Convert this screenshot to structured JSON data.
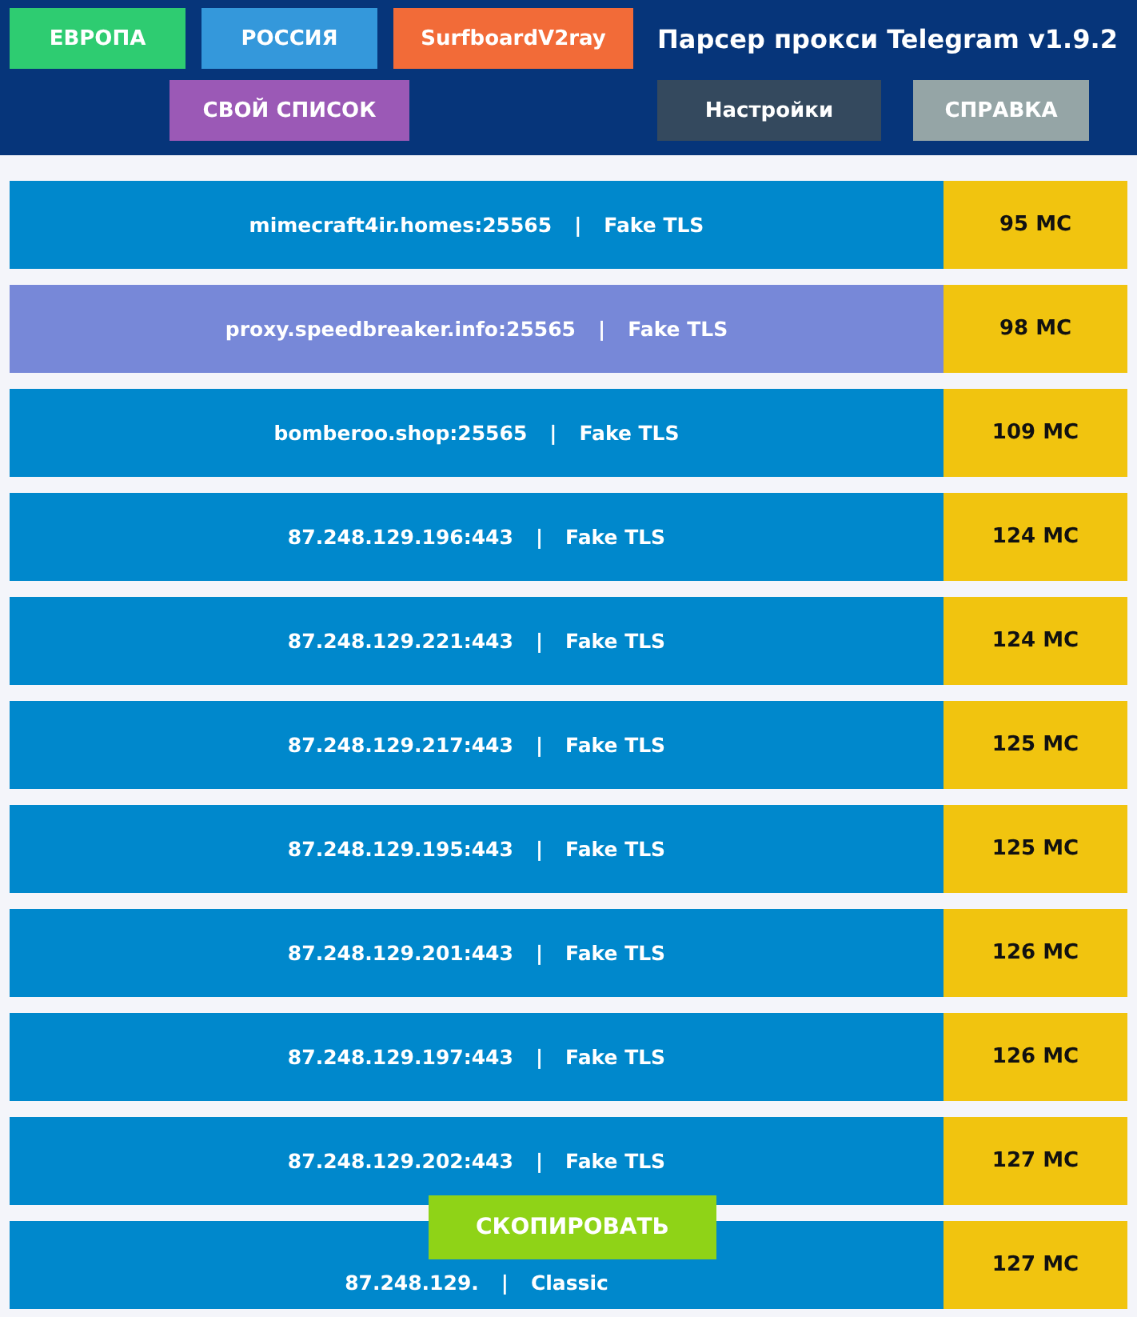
{
  "header": {
    "title": "Парсер прокси Telegram v1.9.2",
    "buttons_row1": [
      {
        "label": "ЕВРОПА",
        "color": "#2ecc71"
      },
      {
        "label": "РОССИЯ",
        "color": "#3498db"
      },
      {
        "label": "SurfboardV2ray",
        "color": "#f26b38"
      }
    ],
    "buttons_row2": [
      {
        "label": "СВОЙ СПИСОК",
        "color": "#9b59b6"
      },
      {
        "label": "Настройки",
        "color": "#34495e"
      },
      {
        "label": "СПРАВКА",
        "color": "#95a5a6"
      }
    ]
  },
  "proxies": [
    {
      "host": "mimecraft4ir.homes:25565",
      "separator": "|",
      "protocol": "Fake TLS",
      "ping": "95 МС",
      "selected": false
    },
    {
      "host": "proxy.speedbreaker.info:25565",
      "separator": "|",
      "protocol": "Fake TLS",
      "ping": "98 МС",
      "selected": true
    },
    {
      "host": "bomberoo.shop:25565",
      "separator": "|",
      "protocol": "Fake TLS",
      "ping": "109 МС",
      "selected": false
    },
    {
      "host": "87.248.129.196:443",
      "separator": "|",
      "protocol": "Fake TLS",
      "ping": "124 МС",
      "selected": false
    },
    {
      "host": "87.248.129.221:443",
      "separator": "|",
      "protocol": "Fake TLS",
      "ping": "124 МС",
      "selected": false
    },
    {
      "host": "87.248.129.217:443",
      "separator": "|",
      "protocol": "Fake TLS",
      "ping": "125 МС",
      "selected": false
    },
    {
      "host": "87.248.129.195:443",
      "separator": "|",
      "protocol": "Fake TLS",
      "ping": "125 МС",
      "selected": false
    },
    {
      "host": "87.248.129.201:443",
      "separator": "|",
      "protocol": "Fake TLS",
      "ping": "126 МС",
      "selected": false
    },
    {
      "host": "87.248.129.197:443",
      "separator": "|",
      "protocol": "Fake TLS",
      "ping": "126 МС",
      "selected": false
    },
    {
      "host": "87.248.129.202:443",
      "separator": "|",
      "protocol": "Fake TLS",
      "ping": "127 МС",
      "selected": false
    },
    {
      "host": "87.248.129.",
      "separator": "|",
      "protocol": "Classic",
      "ping": "127 МС",
      "selected": false
    }
  ],
  "copy_button": {
    "label": "СКОПИРОВАТЬ"
  }
}
